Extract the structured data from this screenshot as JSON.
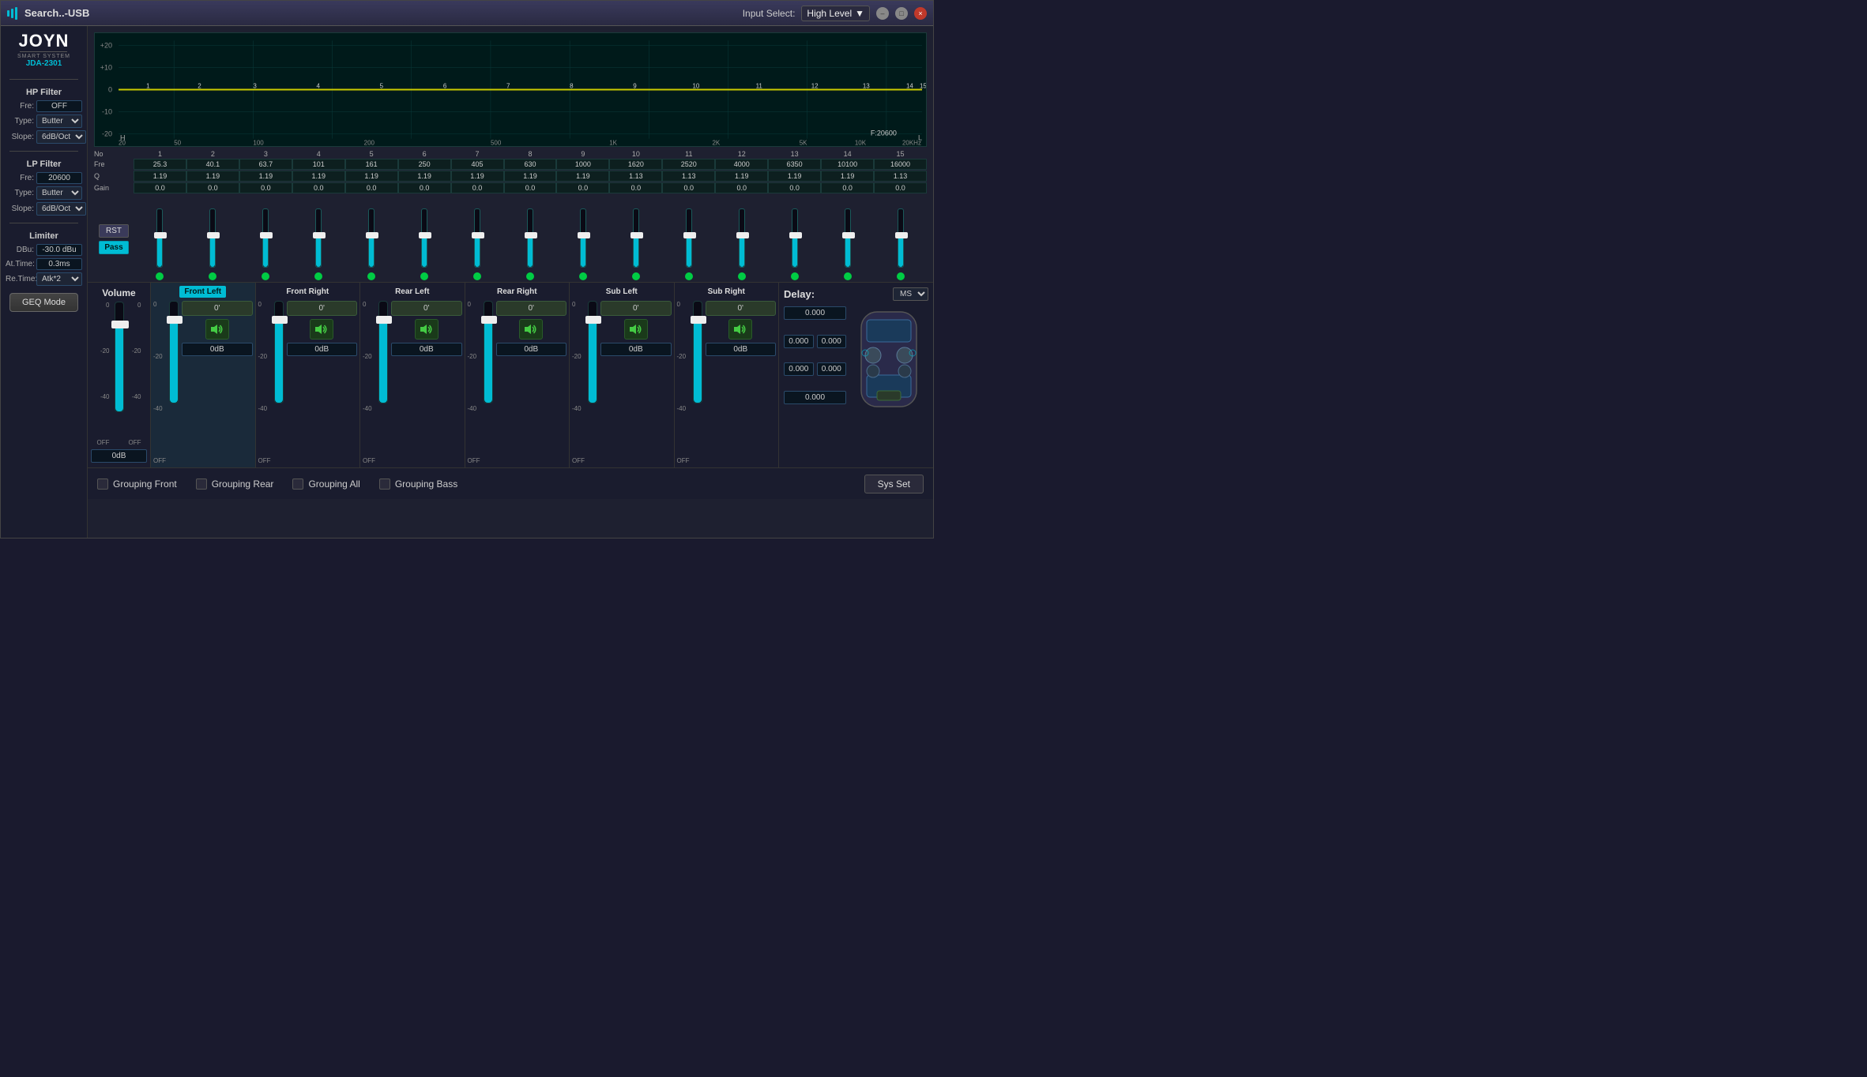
{
  "titlebar": {
    "title": "Search..-USB",
    "input_select_label": "Input Select:",
    "input_select_value": "High Level",
    "min_label": "–",
    "max_label": "□",
    "close_label": "×"
  },
  "sidebar": {
    "logo": "JOYN",
    "logo_sub": "SMART SYSTEM",
    "logo_model": "JDA-2301",
    "hp_filter_title": "HP Filter",
    "hp_fre_label": "Fre:",
    "hp_fre_value": "OFF",
    "hp_type_label": "Type:",
    "hp_type_value": "Butter",
    "hp_slope_label": "Slope:",
    "hp_slope_value": "6dB/Oct",
    "lp_filter_title": "LP Filter",
    "lp_fre_label": "Fre:",
    "lp_fre_value": "20600",
    "lp_type_label": "Type:",
    "lp_type_value": "Butter",
    "lp_slope_label": "Slope:",
    "lp_slope_value": "6dB/Oct",
    "limiter_title": "Limiter",
    "dbu_label": "DBu:",
    "dbu_value": "-30.0 dBu",
    "at_time_label": "At.Time:",
    "at_time_value": "0.3ms",
    "re_time_label": "Re.Time:",
    "re_time_value": "Atk*2",
    "geq_btn": "GEQ Mode"
  },
  "eq_chart": {
    "y_labels": [
      "+20",
      "+10",
      "0",
      "-10",
      "-20"
    ],
    "x_labels": [
      "20",
      "50",
      "100",
      "200",
      "500",
      "1K",
      "2K",
      "5K",
      "10K",
      "20KHz"
    ],
    "freq_display": "F:20600",
    "h_label": "H",
    "l_label": "L"
  },
  "eq_bands": {
    "headers": [
      "No",
      "1",
      "2",
      "3",
      "4",
      "5",
      "6",
      "7",
      "8",
      "9",
      "10",
      "11",
      "12",
      "13",
      "14",
      "15"
    ],
    "fre_label": "Fre",
    "q_label": "Q",
    "gain_label": "Gain",
    "bands": [
      {
        "no": "1",
        "fre": "25.3",
        "q": "1.19",
        "gain": "0.0"
      },
      {
        "no": "2",
        "fre": "40.1",
        "q": "1.19",
        "gain": "0.0"
      },
      {
        "no": "3",
        "fre": "63.7",
        "q": "1.19",
        "gain": "0.0"
      },
      {
        "no": "4",
        "fre": "101",
        "q": "1.19",
        "gain": "0.0"
      },
      {
        "no": "5",
        "fre": "161",
        "q": "1.19",
        "gain": "0.0"
      },
      {
        "no": "6",
        "fre": "250",
        "q": "1.19",
        "gain": "0.0"
      },
      {
        "no": "7",
        "fre": "405",
        "q": "1.19",
        "gain": "0.0"
      },
      {
        "no": "8",
        "fre": "630",
        "q": "1.19",
        "gain": "0.0"
      },
      {
        "no": "9",
        "fre": "1000",
        "q": "1.19",
        "gain": "0.0"
      },
      {
        "no": "10",
        "fre": "1620",
        "q": "1.13",
        "gain": "0.0"
      },
      {
        "no": "11",
        "fre": "2520",
        "q": "1.13",
        "gain": "0.0"
      },
      {
        "no": "12",
        "fre": "4000",
        "q": "1.19",
        "gain": "0.0"
      },
      {
        "no": "13",
        "fre": "6350",
        "q": "1.19",
        "gain": "0.0"
      },
      {
        "no": "14",
        "fre": "10100",
        "q": "1.19",
        "gain": "0.0"
      },
      {
        "no": "15",
        "fre": "16000",
        "q": "1.13",
        "gain": "0.0"
      }
    ]
  },
  "controls": {
    "rst_label": "RST",
    "pass_label": "Pass"
  },
  "volume": {
    "title": "Volume",
    "scale": [
      "0",
      "-20",
      "-40",
      "OFF"
    ],
    "db_value": "0dB"
  },
  "channels": [
    {
      "name": "Front Left",
      "highlight": true,
      "delay": "0'",
      "db": "0dB",
      "fader_pct": 85
    },
    {
      "name": "Front Right",
      "highlight": false,
      "delay": "0'",
      "db": "0dB",
      "fader_pct": 85
    },
    {
      "name": "Rear Left",
      "highlight": false,
      "delay": "0'",
      "db": "0dB",
      "fader_pct": 85
    },
    {
      "name": "Rear Right",
      "highlight": false,
      "delay": "0'",
      "db": "0dB",
      "fader_pct": 85
    },
    {
      "name": "Sub Left",
      "highlight": false,
      "delay": "0'",
      "db": "0dB",
      "fader_pct": 85
    },
    {
      "name": "Sub Right",
      "highlight": false,
      "delay": "0'",
      "db": "0dB",
      "fader_pct": 85
    }
  ],
  "delay": {
    "title": "Delay:",
    "unit": "MS",
    "values": [
      "0.000",
      "0.000",
      "0.000",
      "0.000",
      "0.000"
    ]
  },
  "grouping": {
    "items": [
      "Grouping Front",
      "Grouping Rear",
      "Grouping All",
      "Grouping Bass"
    ],
    "sys_set": "Sys Set"
  }
}
